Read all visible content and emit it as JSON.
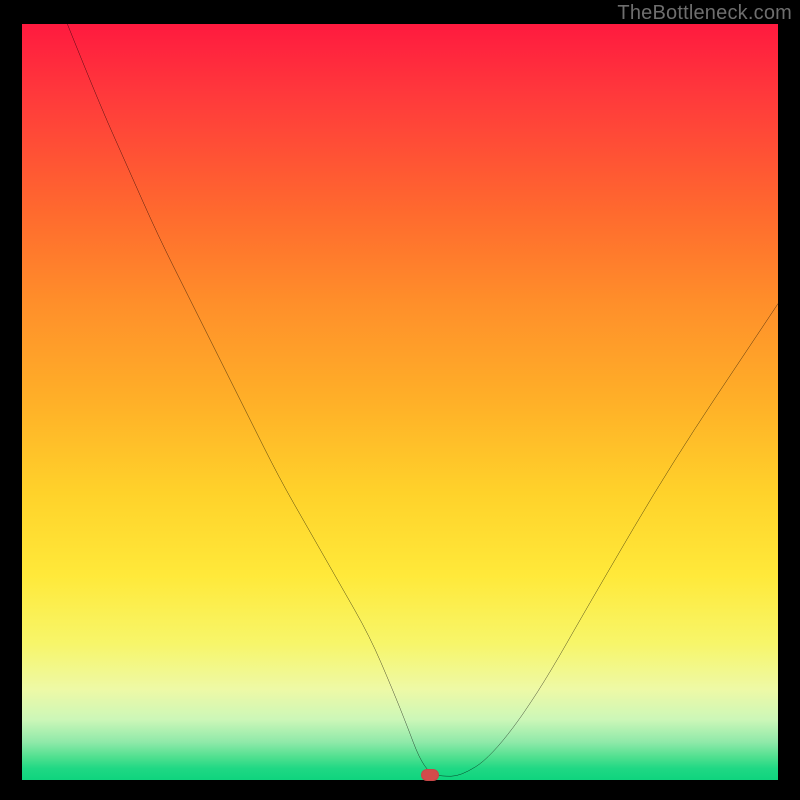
{
  "watermark": "TheBottleneck.com",
  "chart_data": {
    "type": "line",
    "title": "",
    "xlabel": "",
    "ylabel": "",
    "xlim": [
      0,
      100
    ],
    "ylim": [
      0,
      100
    ],
    "grid": false,
    "legend": false,
    "background_gradient": {
      "top": "#ff1a3f",
      "bottom": "#0fd47e",
      "orientation": "vertical"
    },
    "series": [
      {
        "name": "bottleneck-curve",
        "x": [
          6,
          10,
          14,
          18,
          22,
          26,
          30,
          34,
          38,
          42,
          46,
          49,
          51,
          52.5,
          54,
          55.5,
          58,
          62,
          68,
          76,
          86,
          98,
          100
        ],
        "y": [
          100,
          90,
          81,
          72,
          64,
          56,
          48,
          40,
          33,
          26,
          19,
          12,
          7,
          3,
          0.8,
          0.5,
          0.5,
          3,
          11,
          25,
          42,
          60,
          63
        ],
        "color": "#000000"
      }
    ],
    "marker": {
      "name": "optimum-marker",
      "x": 54,
      "y": 0.6,
      "color": "#d34b4b",
      "shape": "rounded-rect"
    }
  }
}
